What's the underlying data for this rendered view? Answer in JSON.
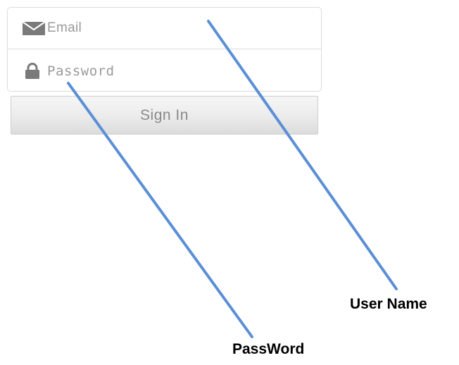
{
  "form": {
    "email_placeholder": "Email",
    "password_placeholder": "Password",
    "signin_label": "Sign In"
  },
  "icons": {
    "email": "envelope-icon",
    "password": "lock-icon"
  },
  "annotations": {
    "username_label": "User Name",
    "password_label": "PassWord"
  },
  "colors": {
    "annotation_line": "#5b8fd6",
    "icon": "#7a7a7a",
    "border": "#dcdcdc",
    "placeholder": "#9a9a9a"
  }
}
